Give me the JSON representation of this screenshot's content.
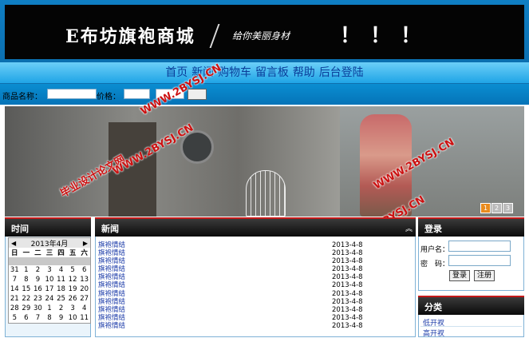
{
  "header": {
    "logo": "E布坊旗袍商城",
    "slogan": "给你美丽身材",
    "exclaim": "！！！"
  },
  "nav": {
    "items": [
      "首页",
      "新闻",
      "购物车",
      "留言板",
      "帮助",
      "后台登陆"
    ]
  },
  "search": {
    "name_label": "商品名称：",
    "price_label": "价格：",
    "name_value": "",
    "price_min_value": "",
    "price_max_value": "",
    "button_label": ""
  },
  "banner": {
    "pages": [
      "1",
      "2",
      "3"
    ],
    "active_page": 1
  },
  "watermarks": [
    "毕业设计论文网",
    "WWW.2BYSJ.CN"
  ],
  "left_panel": {
    "title": "时间",
    "calendar": {
      "prev": "◀",
      "month": "2013年4月",
      "next": "▶",
      "weekdays": [
        "日",
        "一",
        "二",
        "三",
        "四",
        "五",
        "六"
      ],
      "weeks": [
        [
          "31",
          "1",
          "2",
          "3",
          "4",
          "5",
          "6"
        ],
        [
          "7",
          "8",
          "9",
          "10",
          "11",
          "12",
          "13"
        ],
        [
          "14",
          "15",
          "16",
          "17",
          "18",
          "19",
          "20"
        ],
        [
          "21",
          "22",
          "23",
          "24",
          "25",
          "26",
          "27"
        ],
        [
          "28",
          "29",
          "30",
          "1",
          "2",
          "3",
          "4"
        ],
        [
          "5",
          "6",
          "7",
          "8",
          "9",
          "10",
          "11"
        ]
      ]
    }
  },
  "news": {
    "title": "新闻",
    "items": [
      {
        "title": "旗袍情结",
        "date": "2013-4-8"
      },
      {
        "title": "旗袍情结",
        "date": "2013-4-8"
      },
      {
        "title": "旗袍情结",
        "date": "2013-4-8"
      },
      {
        "title": "旗袍情结",
        "date": "2013-4-8"
      },
      {
        "title": "旗袍情结",
        "date": "2013-4-8"
      },
      {
        "title": "旗袍情结",
        "date": "2013-4-8"
      },
      {
        "title": "旗袍情结",
        "date": "2013-4-8"
      },
      {
        "title": "旗袍情结",
        "date": "2013-4-8"
      },
      {
        "title": "旗袍情结",
        "date": "2013-4-8"
      },
      {
        "title": "旗袍情结",
        "date": "2013-4-8"
      },
      {
        "title": "旗袍情结",
        "date": "2013-4-8"
      }
    ]
  },
  "login": {
    "title": "登录",
    "username_label": "用户名：",
    "password_label": "密　码：",
    "login_button": "登录",
    "register_button": "注册"
  },
  "category": {
    "title": "分类",
    "items": [
      "低开衩",
      "高开衩"
    ]
  },
  "colors": {
    "header_bg": "#0b6fb0",
    "nav_text": "#0a3d99",
    "title_bar_accent": "#c41a1a",
    "link": "#1a3aa8",
    "pager_active": "#e98b1e",
    "watermark": "#cc1111"
  }
}
